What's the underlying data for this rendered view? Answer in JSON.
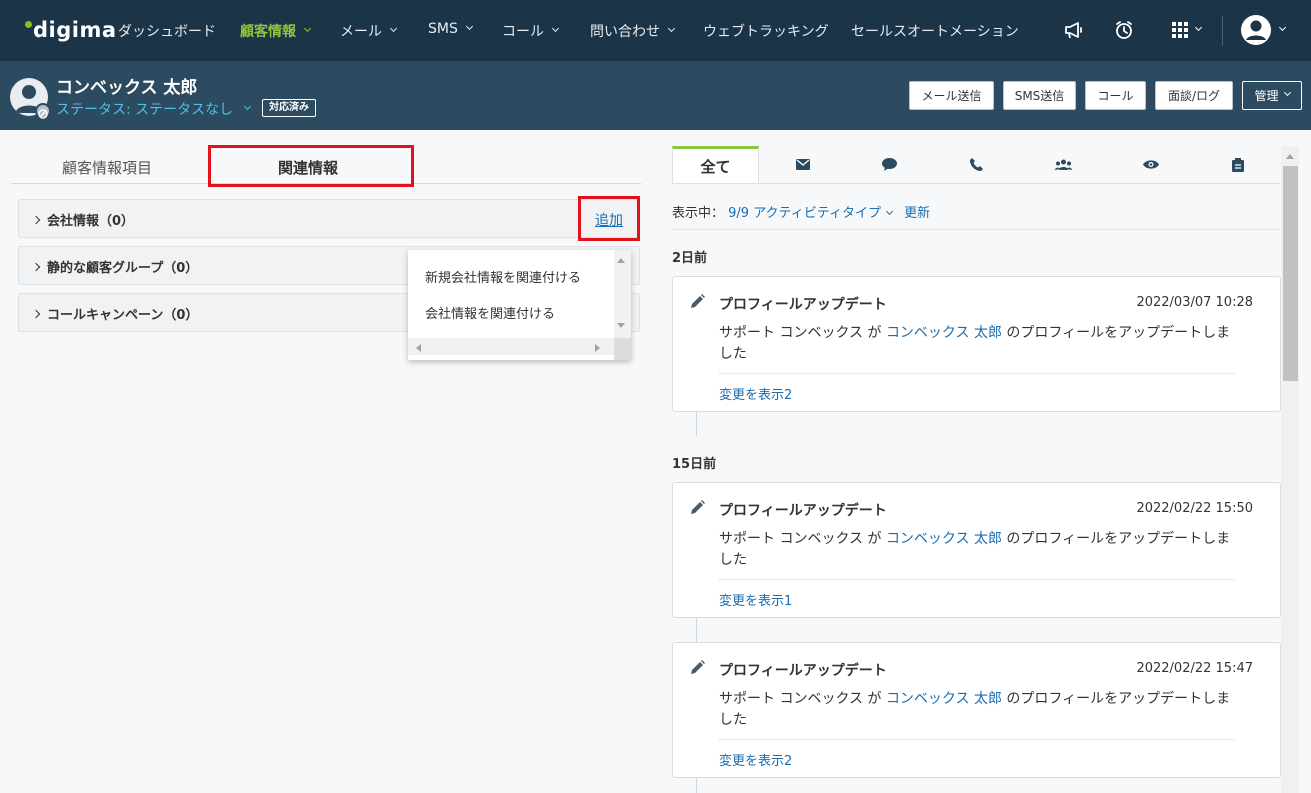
{
  "nav": {
    "logo": "digima",
    "items": [
      {
        "label": "ダッシュボード"
      },
      {
        "label": "顧客情報",
        "active": true
      },
      {
        "label": "メール"
      },
      {
        "label": "SMS"
      },
      {
        "label": "コール"
      },
      {
        "label": "問い合わせ"
      },
      {
        "label": "ウェブトラッキング"
      },
      {
        "label": "セールスオートメーション"
      }
    ]
  },
  "header": {
    "customer_name": "コンベックス 太郎",
    "status": "ステータス: ステータスなし",
    "badge": "対応済み",
    "buttons": [
      "メール送信",
      "SMS送信",
      "コール",
      "面談/ログ",
      "管理"
    ]
  },
  "left": {
    "tabs": [
      "顧客情報項目",
      "関連情報"
    ],
    "sections": [
      {
        "label": "会社情報（0）"
      },
      {
        "label": "静的な顧客グループ（0）"
      },
      {
        "label": "コールキャンペーン（0）"
      }
    ],
    "add_label": "追加",
    "dropdown": [
      "新規会社情報を関連付ける",
      "会社情報を関連付ける"
    ]
  },
  "right": {
    "tab_all": "全て",
    "tab_icons": [
      "mail-icon",
      "chat-icon",
      "phone-icon",
      "group-icon",
      "eye-icon",
      "clipboard-icon"
    ],
    "showing_prefix": "表示中：",
    "activity_types": "9/9 アクティビティタイプ",
    "refresh": "更新",
    "groups": [
      {
        "date": "2日前"
      },
      {
        "date": "15日前"
      }
    ],
    "cards": [
      {
        "title": "プロフィールアップデート",
        "timestamp": "2022/03/07 10:28",
        "actor": "サポート コンベックス が",
        "link": "コンベックス 太郎",
        "rest": "のプロフィールをアップデートしました",
        "changes": "変更を表示2"
      },
      {
        "title": "プロフィールアップデート",
        "timestamp": "2022/02/22 15:50",
        "actor": "サポート コンベックス が",
        "link": "コンベックス 太郎",
        "rest": "のプロフィールをアップデートしました",
        "changes": "変更を表示1"
      },
      {
        "title": "プロフィールアップデート",
        "timestamp": "2022/02/22 15:47",
        "actor": "サポート コンベックス が",
        "link": "コンベックス 太郎",
        "rest": "のプロフィールをアップデートしました",
        "changes": "変更を表示2"
      }
    ]
  },
  "colors": {
    "nav_bg": "#1c3448",
    "header_bg": "#2c4a60",
    "accent_green": "#8cc63f",
    "link_blue": "#1a6db0",
    "highlight_red": "#e4111b"
  }
}
